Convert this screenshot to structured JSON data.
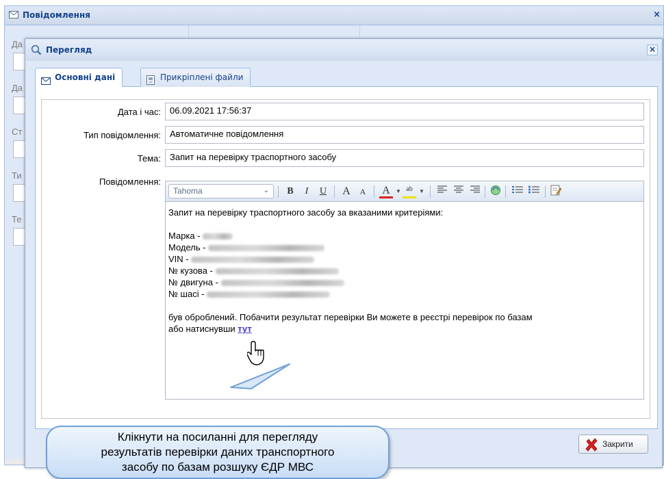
{
  "background_window": {
    "title": "Повідомлення",
    "labels": [
      "Да",
      "Да",
      "Ст",
      "Ти",
      "Те"
    ],
    "close_symbol": "×"
  },
  "dialog": {
    "title": "Перегляд",
    "close_symbol": "×",
    "tabs": [
      {
        "label": "Основні дані",
        "icon": "envelope-icon",
        "active": true
      },
      {
        "label": "Прикріплені файли",
        "icon": "attachment-icon",
        "active": false
      }
    ]
  },
  "form": {
    "datetime_label": "Дата і час:",
    "datetime_value": "06.09.2021 17:56:37",
    "type_label": "Тип повідомлення:",
    "type_value": "Автоматичне повідомлення",
    "subject_label": "Тема:",
    "subject_value": "Запит на перевірку траспортного засобу",
    "message_label": "Повідомлення:"
  },
  "editor": {
    "font": "Tahoma",
    "toolbar": {
      "bold": "B",
      "italic": "I",
      "underline": "U",
      "grow": "A",
      "shrink": "A",
      "font_color": "A",
      "highlight": "ab"
    },
    "intro": "Запит на перевірку траспортного засобу за вказаними критеріями:",
    "fields": [
      {
        "label": "Марка -"
      },
      {
        "label": "Модель -"
      },
      {
        "label": "VIN -"
      },
      {
        "label": "№ кузова -"
      },
      {
        "label": "№ двигуна -"
      },
      {
        "label": "№ шасі -"
      }
    ],
    "closing": "був оброблений. Побачити результат перевірки Ви можете в реєстрі перевірок по базам",
    "closing2": "або натиснувши",
    "link_text": "тут"
  },
  "callout": {
    "line1": "Клікнути на посиланні для перегляду",
    "line2": "результатів перевірки даних транспортного",
    "line3": "засобу по базам розшуку ЄДР МВС"
  },
  "buttons": {
    "close_label": "Закрити"
  },
  "colors": {
    "header_text": "#15428b",
    "border": "#99bbe8",
    "link": "#3f37c9",
    "callout_border": "#6e9fd8"
  }
}
